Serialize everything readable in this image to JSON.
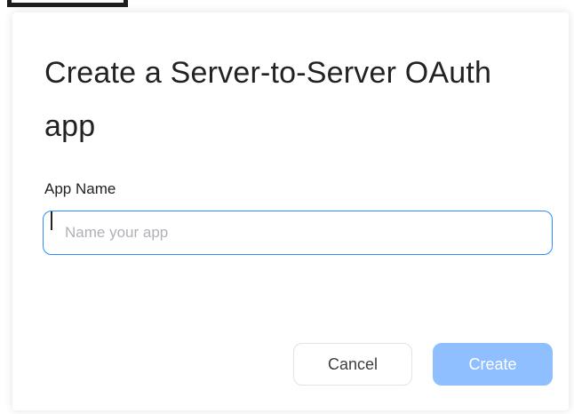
{
  "dialog": {
    "title": "Create a Server-to-Server OAuth app",
    "app_name_label": "App Name",
    "app_name_value": "",
    "app_name_placeholder": "Name your app",
    "cancel_label": "Cancel",
    "create_label": "Create",
    "create_enabled": false
  },
  "colors": {
    "accent": "#2d8cff",
    "create_disabled_bg": "#8fbfff",
    "title_text": "#222222"
  }
}
